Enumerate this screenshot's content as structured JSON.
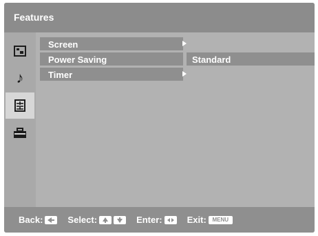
{
  "title": "Features",
  "sidebar": {
    "items": [
      {
        "icon": "picture-icon",
        "active": false
      },
      {
        "icon": "music-note-icon",
        "active": false
      },
      {
        "icon": "features-icon",
        "active": true
      },
      {
        "icon": "toolbox-icon",
        "active": false
      }
    ]
  },
  "menu": {
    "items": [
      {
        "label": "Screen",
        "has_submenu": true
      },
      {
        "label": "Power Saving",
        "has_submenu": false
      },
      {
        "label": "Timer",
        "has_submenu": true
      }
    ],
    "power_saving_value": "Standard"
  },
  "footer": {
    "back_label": "Back:",
    "select_label": "Select:",
    "enter_label": "Enter:",
    "exit_label": "Exit:",
    "menu_key": "MENU"
  },
  "colors": {
    "panel": "#b2b2b2",
    "bar": "#8f8f8f",
    "title_bar": "#8c8c8c",
    "active": "#d7d7d7",
    "text": "#ffffff"
  }
}
